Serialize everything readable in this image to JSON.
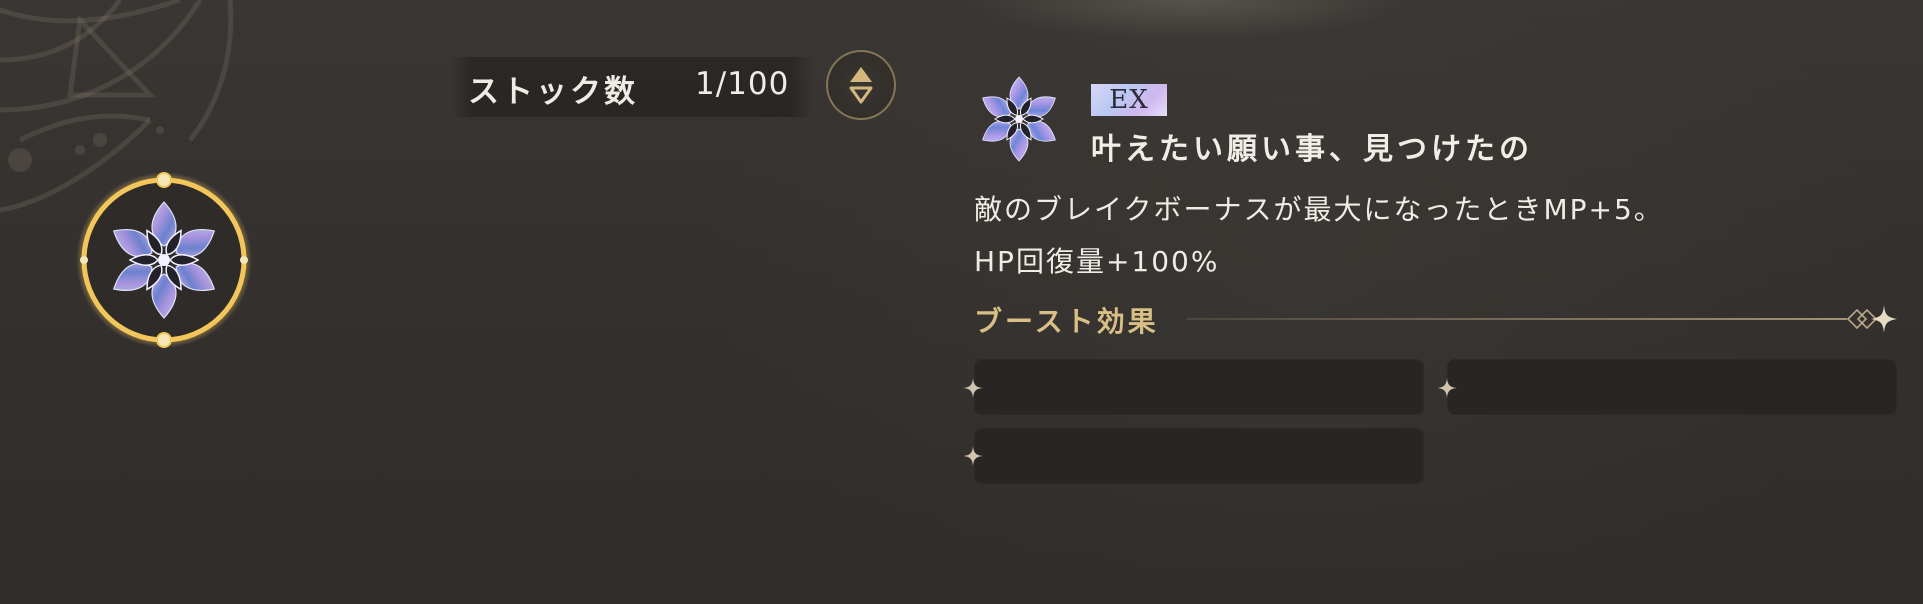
{
  "stock": {
    "label": "ストック数",
    "value": "1/100"
  },
  "item": {
    "rank_badge": "EX",
    "name": "叶えたい願い事、見つけたの",
    "description_line1": "敵のブレイクボーナスが最大になったときMP+5。",
    "description_line2": "HP回復量+100%"
  },
  "boost": {
    "title": "ブースト効果",
    "slots": [
      "",
      "",
      ""
    ]
  },
  "icons": {
    "sort": "sort-toggle-icon",
    "emblem": "crystal-flower-emblem-icon",
    "slot_star": "sparkle-icon"
  },
  "colors": {
    "accent_gold": "#d8bf86",
    "badge_holo": "#c8c6f2",
    "background": "#35322f"
  }
}
